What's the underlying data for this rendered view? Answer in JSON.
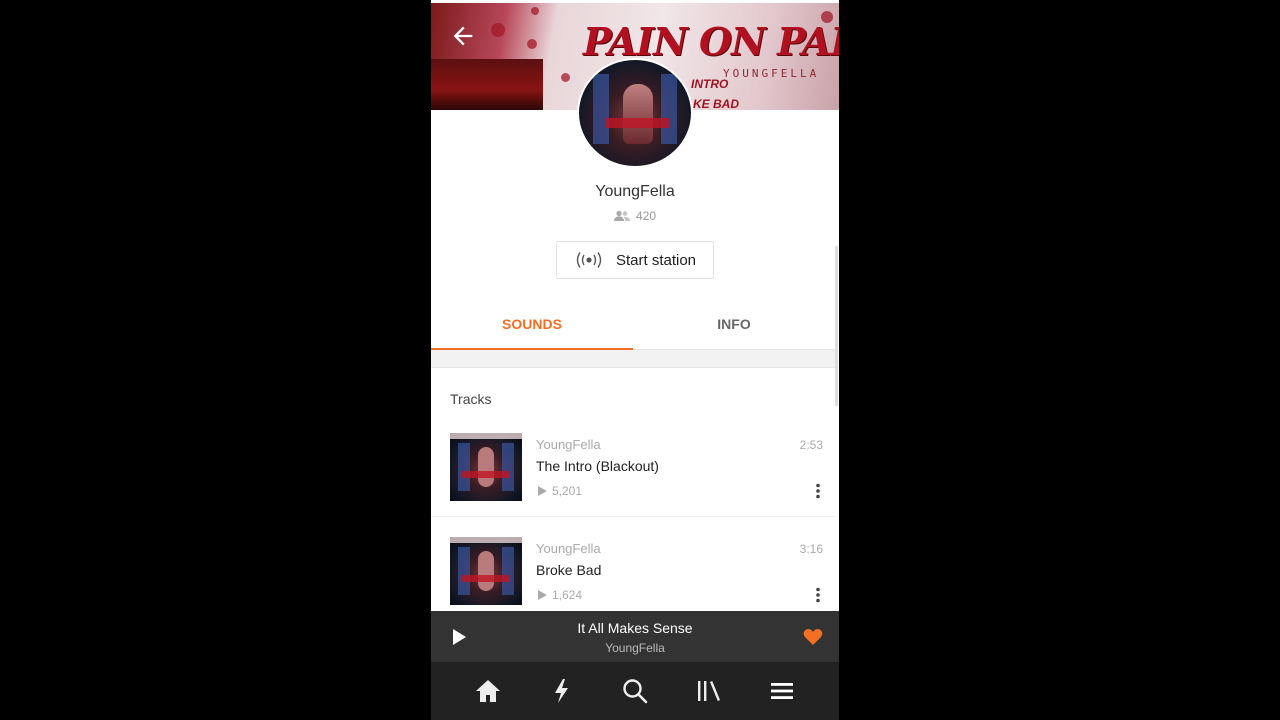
{
  "header": {
    "banner_title": "PAIN ON PAPER",
    "banner_subtitle": "YOUNGFELLA",
    "banner_tracks": [
      "INTRO",
      "KE BAD"
    ]
  },
  "profile": {
    "username": "YoungFella",
    "followers": "420",
    "start_station_label": "Start station"
  },
  "tabs": [
    {
      "label": "SOUNDS",
      "active": true
    },
    {
      "label": "INFO",
      "active": false
    }
  ],
  "tracks_section": {
    "heading": "Tracks",
    "items": [
      {
        "artist": "YoungFella",
        "title": "The Intro (Blackout)",
        "plays": "5,201",
        "duration": "2:53"
      },
      {
        "artist": "YoungFella",
        "title": "Broke Bad",
        "plays": "1,624",
        "duration": "3:16"
      }
    ]
  },
  "mini_player": {
    "title": "It All Makes Sense",
    "artist": "YoungFella",
    "liked": true
  },
  "bottom_nav": [
    "home-icon",
    "stream-icon",
    "search-icon",
    "library-icon",
    "menu-icon"
  ],
  "colors": {
    "accent": "#f26f23",
    "player_bg": "#333333",
    "nav_bg": "#222222"
  }
}
